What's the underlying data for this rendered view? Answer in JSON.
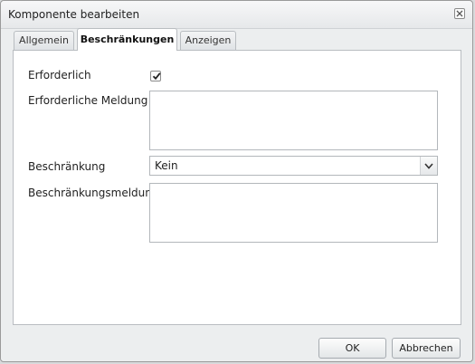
{
  "dialog": {
    "title": "Komponente bearbeiten"
  },
  "tabs": [
    {
      "label": "Allgemein",
      "active": false
    },
    {
      "label": "Beschränkungen",
      "active": true
    },
    {
      "label": "Anzeigen",
      "active": false
    }
  ],
  "form": {
    "required_label": "Erforderlich",
    "required_checked": true,
    "required_message_label": "Erforderliche Meldung",
    "required_message_value": "",
    "constraint_label": "Beschränkung",
    "constraint_value": "Kein",
    "constraint_message_label": "Beschränkungsmeldung",
    "constraint_message_value": ""
  },
  "buttons": {
    "ok_label": "OK",
    "cancel_label": "Abbrechen"
  },
  "icons": {
    "close": "close-icon",
    "checkmark": "checkmark-icon",
    "dropdown": "chevron-down-icon"
  }
}
